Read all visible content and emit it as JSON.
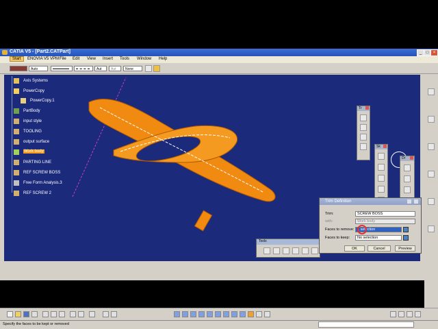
{
  "window": {
    "title": "CATIA V5 - [Part2.CATPart]"
  },
  "menu": [
    "Start",
    "ENOVIA V5 VPM",
    "File",
    "Edit",
    "View",
    "Insert",
    "Tools",
    "Window",
    "Help"
  ],
  "propbar": {
    "color": "Auto",
    "linetype": "Aut",
    "thickness": "Aut",
    "layer": "None"
  },
  "tree": [
    {
      "label": "Axis Systems",
      "icon": "axis-icon"
    },
    {
      "label": "PowerCopy",
      "icon": "folder-icon"
    },
    {
      "label": "PowerCopy.1",
      "icon": "powercopy-icon"
    },
    {
      "label": "PartBody",
      "icon": "body-icon"
    },
    {
      "label": "input style",
      "icon": "geoset-icon"
    },
    {
      "label": "TOOLING",
      "icon": "geoset-icon"
    },
    {
      "label": "output surface",
      "icon": "geoset-icon"
    },
    {
      "label": "Work body",
      "icon": "geoset-icon",
      "selected": true
    },
    {
      "label": "PARTING LINE",
      "icon": "geoset-icon"
    },
    {
      "label": "REF SCREW BOSS",
      "icon": "geoset-icon"
    },
    {
      "label": "Free Form Analysis.3",
      "icon": "analysis-icon"
    },
    {
      "label": "REF SCREW 2",
      "icon": "geoset-icon"
    }
  ],
  "toolbars": {
    "tr": "Tr",
    "sk": "Sk",
    "dr": "Dr"
  },
  "dialog": {
    "title": "Trim Definition",
    "trim_label": "Trim:",
    "trim_value": "SCREW BOSS",
    "with_label": "with:",
    "with_value": "Work body",
    "remove_label": "Faces to remove:",
    "remove_value": "1 selection",
    "keep_label": "Faces to keep:",
    "keep_value": "No selection",
    "ok": "OK",
    "cancel": "Cancel",
    "preview": "Preview"
  },
  "tools_panel": {
    "title": "Tools"
  },
  "status": "Specify the faces to be kept or removed",
  "colors": {
    "viewport": "#1c2a7c",
    "part": "#f08a10",
    "selection": "#f39a18"
  }
}
